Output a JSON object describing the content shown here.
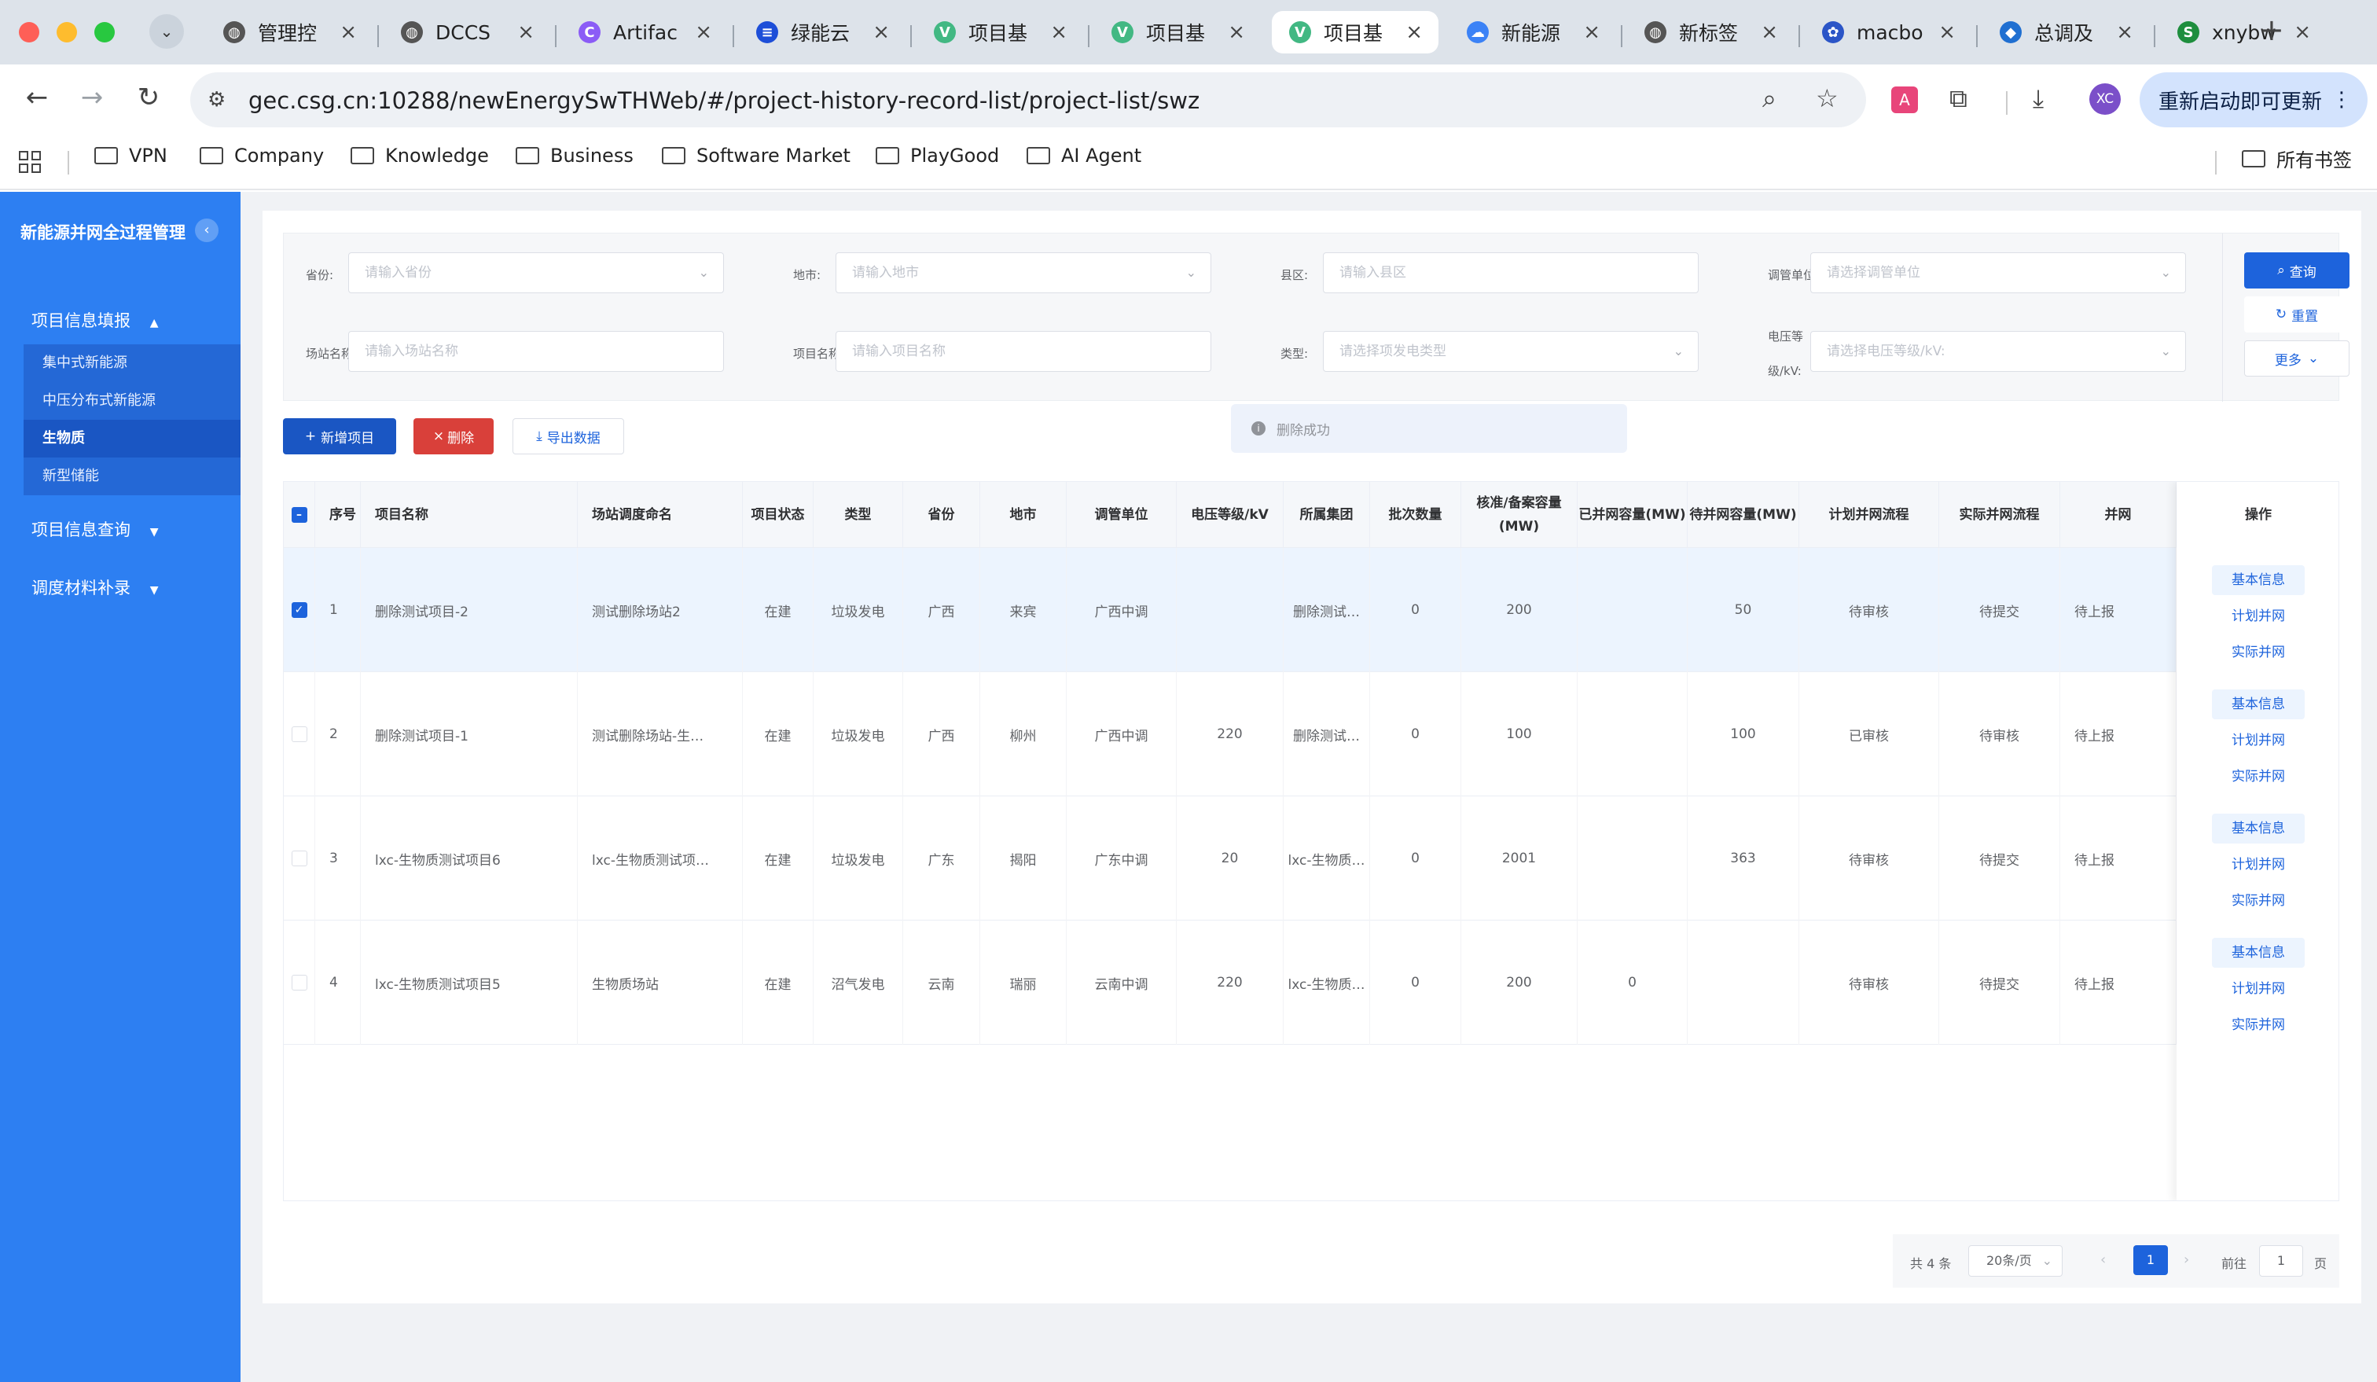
{
  "browser": {
    "tabs": [
      {
        "title": "管理控",
        "icon": "globe",
        "active": false
      },
      {
        "title": "DCCS",
        "icon": "globe",
        "active": false
      },
      {
        "title": "Artifac",
        "icon": "claude",
        "active": false
      },
      {
        "title": "绿能云",
        "icon": "bars",
        "active": false
      },
      {
        "title": "项目基",
        "icon": "vue",
        "active": false
      },
      {
        "title": "项目基",
        "icon": "vue",
        "active": false
      },
      {
        "title": "项目基",
        "icon": "vue",
        "active": true
      },
      {
        "title": "新能源",
        "icon": "cloud",
        "active": false
      },
      {
        "title": "新标签",
        "icon": "globe",
        "active": false
      },
      {
        "title": "macbo",
        "icon": "paw",
        "active": false
      },
      {
        "title": "总调及",
        "icon": "cube",
        "active": false
      },
      {
        "title": "xnybw",
        "icon": "sheet",
        "active": false
      }
    ],
    "url": "gec.csg.cn:10288/newEnergySwTHWeb/#/project-history-record-list/project-list/swz",
    "profile_initials": "XC",
    "update_button": "重新启动即可更新",
    "bookmarks": [
      "VPN",
      "Company",
      "Knowledge",
      "Business",
      "Software Market",
      "PlayGood",
      "AI Agent"
    ],
    "all_bookmarks": "所有书签"
  },
  "sidebar": {
    "title": "新能源并网全过程管理",
    "menus": [
      {
        "label": "项目信息填报",
        "arrow": "▲",
        "expanded": true,
        "children": [
          {
            "label": "集中式新能源",
            "active": false
          },
          {
            "label": "中压分布式新能源",
            "active": false
          },
          {
            "label": "生物质",
            "active": true
          },
          {
            "label": "新型储能",
            "active": false
          }
        ]
      },
      {
        "label": "项目信息查询",
        "arrow": "▼",
        "expanded": false
      },
      {
        "label": "调度材料补录",
        "arrow": "▼",
        "expanded": false
      }
    ]
  },
  "filters": {
    "province": {
      "label": "省份:",
      "placeholder": "请输入省份"
    },
    "city": {
      "label": "地市:",
      "placeholder": "请输入地市"
    },
    "county": {
      "label": "县区:",
      "placeholder": "请输入县区"
    },
    "dispatch": {
      "label": "调管单位:",
      "placeholder": "请选择调管单位"
    },
    "station": {
      "label": "场站名称:",
      "placeholder": "请输入场站名称"
    },
    "project": {
      "label": "项目名称:",
      "placeholder": "请输入项目名称"
    },
    "type": {
      "label": "类型:",
      "placeholder": "请选择项发电类型"
    },
    "voltage": {
      "label_line1": "电压等",
      "label_line2": "级/kV:",
      "placeholder": "请选择电压等级/kV:"
    }
  },
  "buttons": {
    "search": "查询",
    "reset": "重置",
    "more": "更多",
    "add": "新增项目",
    "delete": "删除",
    "export": "导出数据"
  },
  "toast": "删除成功",
  "table": {
    "headers": [
      "序号",
      "项目名称",
      "场站调度命名",
      "项目状态",
      "类型",
      "省份",
      "地市",
      "调管单位",
      "电压等级/kV",
      "所属集团",
      "批次数量",
      "核准/备案容量(MW)",
      "已并网容量(MW)",
      "待并网容量(MW)",
      "计划并网流程",
      "实际并网流程",
      "并网",
      "操作"
    ],
    "rows": [
      {
        "selected": true,
        "cells": [
          "1",
          "删除测试项目-2",
          "测试删除场站2",
          "在建",
          "垃圾发电",
          "广西",
          "来宾",
          "广西中调",
          "",
          "删除测试…",
          "0",
          "200",
          "",
          "50",
          "待审核",
          "待提交",
          "待上报"
        ]
      },
      {
        "selected": false,
        "cells": [
          "2",
          "删除测试项目-1",
          "测试删除场站-生…",
          "在建",
          "垃圾发电",
          "广西",
          "柳州",
          "广西中调",
          "220",
          "删除测试…",
          "0",
          "100",
          "",
          "100",
          "已审核",
          "待审核",
          "待上报"
        ]
      },
      {
        "selected": false,
        "cells": [
          "3",
          "lxc-生物质测试项目6",
          "lxc-生物质测试项…",
          "在建",
          "垃圾发电",
          "广东",
          "揭阳",
          "广东中调",
          "20",
          "lxc-生物质…",
          "0",
          "2001",
          "",
          "363",
          "待审核",
          "待提交",
          "待上报"
        ]
      },
      {
        "selected": false,
        "cells": [
          "4",
          "lxc-生物质测试项目5",
          "生物质场站",
          "在建",
          "沼气发电",
          "云南",
          "瑞丽",
          "云南中调",
          "220",
          "lxc-生物质…",
          "0",
          "200",
          "0",
          "",
          "待审核",
          "待提交",
          "待上报"
        ]
      }
    ],
    "actions": [
      "基本信息",
      "计划并网",
      "实际并网"
    ]
  },
  "pagination": {
    "total": "共 4 条",
    "page_size": "20条/页",
    "current": "1",
    "goto_label": "前往",
    "goto_value": "1",
    "page_suffix": "页"
  },
  "colors": {
    "sidebar": "#2d7ff2",
    "primary": "#1d63dc",
    "danger": "#d9403a",
    "selected_row": "#ecf4fe"
  }
}
